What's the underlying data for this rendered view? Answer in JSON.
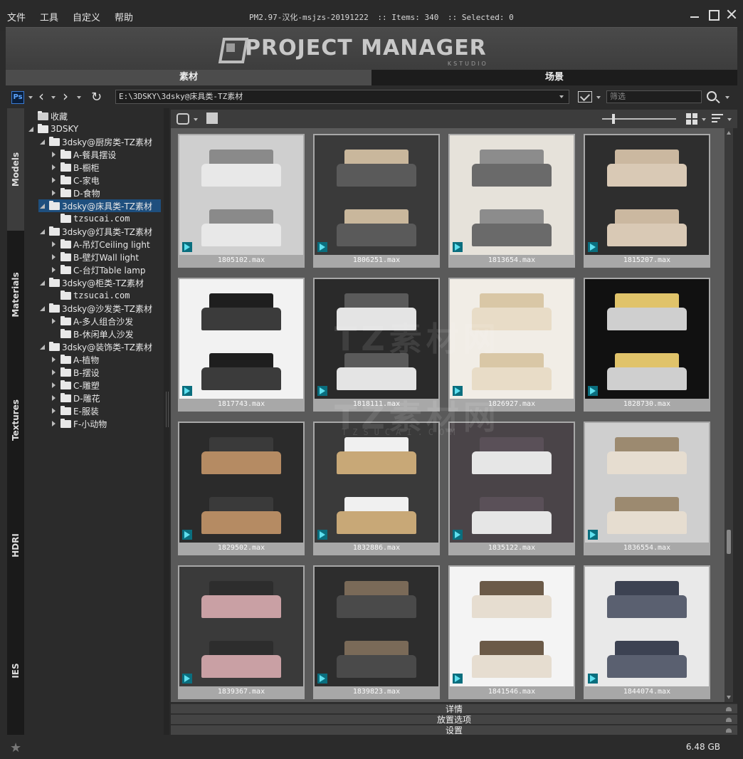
{
  "menu": [
    "文件",
    "工具",
    "自定义",
    "帮助"
  ],
  "title": {
    "app": "PM2.97-汉化-msjzs-20191222",
    "items": ":: Items: 340",
    "selected": ":: Selected: 0"
  },
  "banner": {
    "logo": "PROJECT MANAGER",
    "sub": "KSTUDIO"
  },
  "top_tabs": {
    "assets": "素材",
    "scenes": "场景"
  },
  "path": {
    "ps": "Ps",
    "value": "E:\\3DSKY\\3dsky@床具类-TZ素材",
    "filter_placeholder": "筛选"
  },
  "side_tabs": [
    "Models",
    "Materials",
    "Textures",
    "HDRI",
    "IES"
  ],
  "tree": [
    {
      "label": "收藏",
      "indent": 0,
      "toggle": "none",
      "star": true
    },
    {
      "label": "3DSKY",
      "indent": 0,
      "toggle": "open"
    },
    {
      "label": "3dsky@厨房类-TZ素材",
      "indent": 1,
      "toggle": "open"
    },
    {
      "label": "A-餐具摆设",
      "indent": 2,
      "toggle": "closed"
    },
    {
      "label": "B-橱柜",
      "indent": 2,
      "toggle": "closed"
    },
    {
      "label": "C-家电",
      "indent": 2,
      "toggle": "closed"
    },
    {
      "label": "D-食物",
      "indent": 2,
      "toggle": "closed"
    },
    {
      "label": "3dsky@床具类-TZ素材",
      "indent": 1,
      "toggle": "open",
      "selected": true
    },
    {
      "label": "tzsucai.com",
      "indent": 2,
      "toggle": "none",
      "mono": true
    },
    {
      "label": "3dsky@灯具类-TZ素材",
      "indent": 1,
      "toggle": "open"
    },
    {
      "label": "A-吊灯Ceiling light",
      "indent": 2,
      "toggle": "closed"
    },
    {
      "label": "B-壁灯Wall light",
      "indent": 2,
      "toggle": "closed"
    },
    {
      "label": "C-台灯Table lamp",
      "indent": 2,
      "toggle": "closed"
    },
    {
      "label": "3dsky@柜类-TZ素材",
      "indent": 1,
      "toggle": "open"
    },
    {
      "label": "tzsucai.com",
      "indent": 2,
      "toggle": "none",
      "mono": true
    },
    {
      "label": "3dsky@沙发类-TZ素材",
      "indent": 1,
      "toggle": "open"
    },
    {
      "label": "A-多人组合沙发",
      "indent": 2,
      "toggle": "closed"
    },
    {
      "label": "B-休闲单人沙发",
      "indent": 2,
      "toggle": "none"
    },
    {
      "label": "3dsky@装饰类-TZ素材",
      "indent": 1,
      "toggle": "open"
    },
    {
      "label": "A-植物",
      "indent": 2,
      "toggle": "closed"
    },
    {
      "label": "B-摆设",
      "indent": 2,
      "toggle": "closed"
    },
    {
      "label": "C-雕塑",
      "indent": 2,
      "toggle": "closed"
    },
    {
      "label": "D-雕花",
      "indent": 2,
      "toggle": "closed"
    },
    {
      "label": "E-服装",
      "indent": 2,
      "toggle": "closed"
    },
    {
      "label": "F-小动物",
      "indent": 2,
      "toggle": "closed"
    }
  ],
  "items": [
    {
      "name": "1805102.max",
      "bg": "#cfcfcf",
      "bed": "#e8e8e8",
      "head": "#8a8a8a"
    },
    {
      "name": "1806251.max",
      "bg": "#3a3a3a",
      "bed": "#5a5a5a",
      "head": "#c9b79c"
    },
    {
      "name": "1813654.max",
      "bg": "#e6e2da",
      "bed": "#6a6a6a",
      "head": "#8c8c8c"
    },
    {
      "name": "1815207.max",
      "bg": "#2e2e2e",
      "bed": "#d9c9b5",
      "head": "#cbb8a0"
    },
    {
      "name": "1817743.max",
      "bg": "#f2f2f2",
      "bed": "#3b3b3b",
      "head": "#1e1e1e"
    },
    {
      "name": "1818111.max",
      "bg": "#2a2a2a",
      "bed": "#e4e4e4",
      "head": "#5a5a5a"
    },
    {
      "name": "1826927.max",
      "bg": "#f1ede6",
      "bed": "#e8dcc7",
      "head": "#d9c7a6"
    },
    {
      "name": "1828730.max",
      "bg": "#111111",
      "bed": "#cfcfcf",
      "head": "#e0c36a"
    },
    {
      "name": "1829502.max",
      "bg": "#2b2b2b",
      "bed": "#b58b63",
      "head": "#3a3a3a"
    },
    {
      "name": "1832886.max",
      "bg": "#3a3a3a",
      "bed": "#c8a877",
      "head": "#f0f0f0"
    },
    {
      "name": "1835122.max",
      "bg": "#4a4448",
      "bed": "#e6e6e6",
      "head": "#5a5058"
    },
    {
      "name": "1836554.max",
      "bg": "#cfcfcf",
      "bed": "#e6ddd0",
      "head": "#9c8a70"
    },
    {
      "name": "1839367.max",
      "bg": "#3a3a3a",
      "bed": "#c9a0a4",
      "head": "#2d2d2d"
    },
    {
      "name": "1839823.max",
      "bg": "#2d2d2d",
      "bed": "#4a4a4a",
      "head": "#7a6a58"
    },
    {
      "name": "1841546.max",
      "bg": "#f4f4f4",
      "bed": "#e6ddd0",
      "head": "#6b5a48"
    },
    {
      "name": "1844074.max",
      "bg": "#e9e9e9",
      "bed": "#5a6070",
      "head": "#3c4252"
    }
  ],
  "accordion": [
    "详情",
    "放置选项",
    "设置"
  ],
  "status": {
    "size": "6.48 GB"
  }
}
